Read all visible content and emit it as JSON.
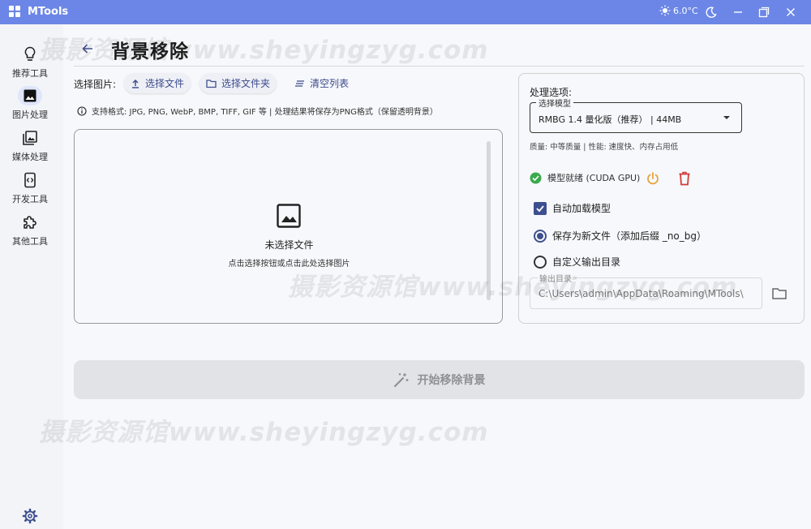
{
  "titlebar": {
    "app_title": "MTools",
    "weather_temp": "6.0°C",
    "icons": [
      "weather-sun-icon",
      "theme-moon-icon",
      "minimize-icon",
      "maximize-icon",
      "close-icon"
    ]
  },
  "sidebar": {
    "items": [
      {
        "label": "推荐工具",
        "icon": "lightbulb-icon",
        "active": false
      },
      {
        "label": "图片处理",
        "icon": "image-icon",
        "active": true
      },
      {
        "label": "媒体处理",
        "icon": "media-library-icon",
        "active": false
      },
      {
        "label": "开发工具",
        "icon": "code-icon",
        "active": false
      },
      {
        "label": "其他工具",
        "icon": "puzzle-icon",
        "active": false
      }
    ],
    "settings_icon": "gear-icon"
  },
  "header": {
    "title": "背景移除"
  },
  "toolbar": {
    "select_label": "选择图片:",
    "select_file": "选择文件",
    "select_folder": "选择文件夹",
    "clear_list": "清空列表",
    "info": "支持格式: JPG, PNG, WebP, BMP, TIFF, GIF 等 | 处理结果将保存为PNG格式（保留透明背景）"
  },
  "dropzone": {
    "title": "未选择文件",
    "subtitle": "点击选择按钮或点击此处选择图片"
  },
  "options": {
    "title": "处理选项:",
    "model_legend": "选择模型",
    "model_value": "RMBG 1.4 量化版（推荐）  |  44MB",
    "quality": "质量: 中等质量 | 性能: 速度快、内存占用低",
    "status": "模型就绪 (CUDA GPU)",
    "auto_load": "自动加载模型",
    "save_new": "保存为新文件（添加后缀 _no_bg）",
    "custom_dir": "自定义输出目录",
    "output_legend": "输出目录",
    "output_value": "C:\\Users\\admin\\AppData\\Roaming\\MTools\\"
  },
  "start_button": "开始移除背景",
  "watermark": "摄影资源馆www.sheyingzyg.com",
  "colors": {
    "titlebar": "#6b86e6",
    "accent": "#3e4f8f",
    "ready_green": "#3aaa4f",
    "power_orange": "#e8a33b",
    "delete_red": "#d23b3b"
  }
}
